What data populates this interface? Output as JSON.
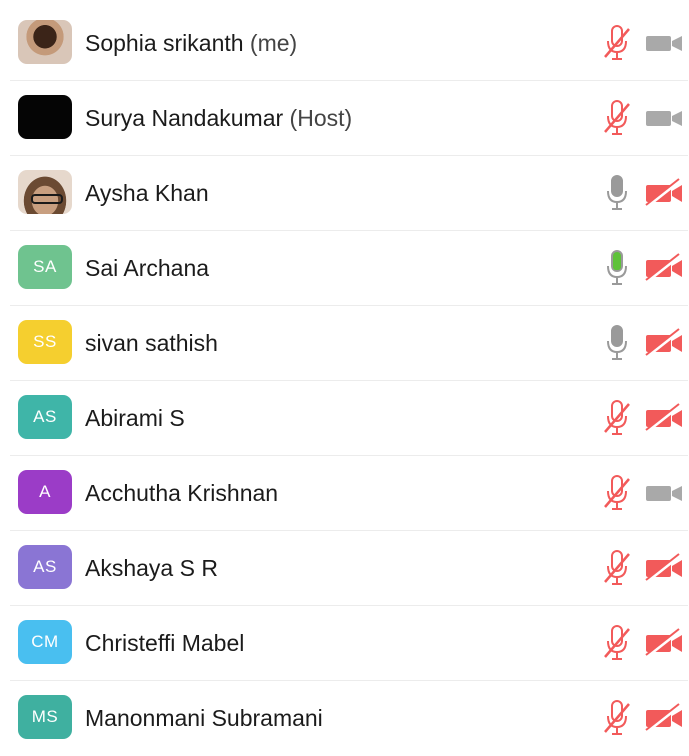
{
  "colors": {
    "muted_red": "#f25a5a",
    "mic_gray": "#9a9a9a",
    "mic_active_green": "#5ec23a",
    "cam_gray": "#a9a9a9"
  },
  "participants": [
    {
      "name": "Sophia srikanth",
      "suffix": " (me)",
      "initials": "",
      "avatar": "photo",
      "avatar_color": "#d9c6b8",
      "mic": "muted",
      "cam": "on"
    },
    {
      "name": "Surya Nandakumar",
      "suffix": " (Host)",
      "initials": "",
      "avatar": "solid",
      "avatar_color": "#050505",
      "mic": "muted",
      "cam": "on"
    },
    {
      "name": "Aysha Khan",
      "suffix": "",
      "initials": "",
      "avatar": "photo",
      "avatar_color": "#e6d8cc",
      "mic": "on",
      "cam": "off"
    },
    {
      "name": "Sai Archana",
      "suffix": "",
      "initials": "SA",
      "avatar": "initials",
      "avatar_color": "#6fc38f",
      "mic": "speaking",
      "cam": "off"
    },
    {
      "name": "sivan sathish",
      "suffix": "",
      "initials": "SS",
      "avatar": "initials",
      "avatar_color": "#f5cf2f",
      "mic": "on",
      "cam": "off"
    },
    {
      "name": "Abirami S",
      "suffix": "",
      "initials": "AS",
      "avatar": "initials",
      "avatar_color": "#3fb5a8",
      "mic": "muted",
      "cam": "off"
    },
    {
      "name": "Acchutha Krishnan",
      "suffix": "",
      "initials": "A",
      "avatar": "initials",
      "avatar_color": "#9b3cc7",
      "mic": "muted",
      "cam": "on"
    },
    {
      "name": "Akshaya S R",
      "suffix": "",
      "initials": "AS",
      "avatar": "initials",
      "avatar_color": "#8a75d4",
      "mic": "muted",
      "cam": "off"
    },
    {
      "name": "Christeffi Mabel",
      "suffix": "",
      "initials": "CM",
      "avatar": "initials",
      "avatar_color": "#49bff0",
      "mic": "muted",
      "cam": "off"
    },
    {
      "name": "Manonmani Subramani",
      "suffix": "",
      "initials": "MS",
      "avatar": "initials",
      "avatar_color": "#3fb0a0",
      "mic": "muted",
      "cam": "off"
    }
  ]
}
